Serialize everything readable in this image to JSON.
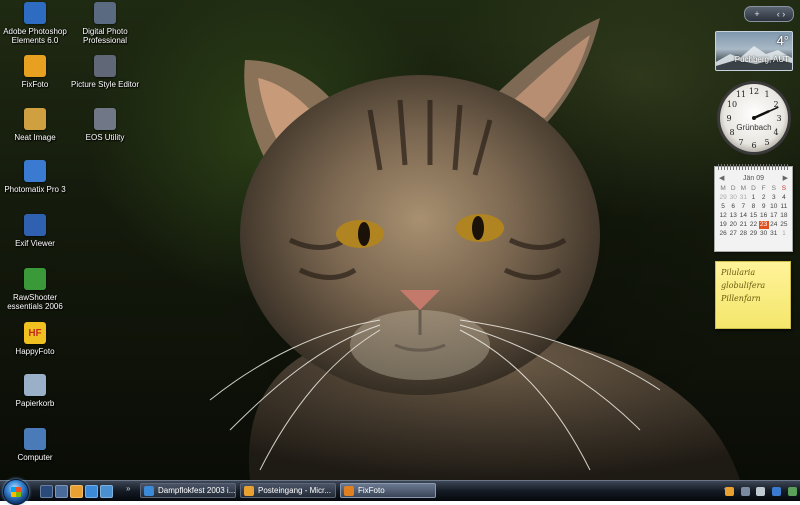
{
  "desktop": {
    "icons": [
      {
        "label": "Adobe Photoshop\nElements 6.0",
        "icon": "photoshop-elements-icon",
        "color": "#2d6cc0"
      },
      {
        "label": "Digital Photo\nProfessional",
        "icon": "digital-photo-professional-icon",
        "color": "#5a6a80"
      },
      {
        "label": "FixFoto",
        "icon": "fixfoto-icon",
        "color": "#e8a020"
      },
      {
        "label": "Picture Style Editor",
        "icon": "picture-style-editor-icon",
        "color": "#606878"
      },
      {
        "label": "Neat Image",
        "icon": "neat-image-icon",
        "color": "#d0a040"
      },
      {
        "label": "EOS Utility",
        "icon": "eos-utility-icon",
        "color": "#707888"
      },
      {
        "label": "Photomatix Pro 3",
        "icon": "photomatix-icon",
        "color": "#3a7ad0"
      },
      {
        "label": "Exif Viewer",
        "icon": "exif-viewer-icon",
        "color": "#3060b0"
      },
      {
        "label": "RawShooter\nessentials 2006",
        "icon": "rawshooter-icon",
        "color": "#3a9a3a"
      },
      {
        "label": "HappyFoto",
        "icon": "happyfoto-icon",
        "color": "#f0c020",
        "glyph": "HF"
      },
      {
        "label": "Papierkorb",
        "icon": "recycle-bin-icon",
        "color": "#9ab0c8"
      },
      {
        "label": "Computer",
        "icon": "computer-icon",
        "color": "#4a7ab8"
      }
    ]
  },
  "sidebar": {
    "controls": {
      "add": "+",
      "nav": "‹ ›"
    },
    "weather": {
      "temp": "4°",
      "city": "Puchberg, AUT"
    },
    "clock": {
      "city": "Grünbach",
      "hour": 2,
      "minute": 11
    },
    "calendar": {
      "month": "Jän 09",
      "weekdays": [
        "M",
        "D",
        "M",
        "D",
        "F",
        "S",
        "S"
      ],
      "weeks": [
        [
          "29",
          "30",
          "31",
          "1",
          "2",
          "3",
          "4"
        ],
        [
          "5",
          "6",
          "7",
          "8",
          "9",
          "10",
          "11"
        ],
        [
          "12",
          "13",
          "14",
          "15",
          "16",
          "17",
          "18"
        ],
        [
          "19",
          "20",
          "21",
          "22",
          "23",
          "24",
          "25"
        ],
        [
          "26",
          "27",
          "28",
          "29",
          "30",
          "31",
          "1"
        ]
      ],
      "today": "23"
    },
    "note": {
      "lines": [
        "Pilularia",
        "globulifera",
        "Pillenfarn"
      ]
    }
  },
  "taskbar": {
    "tasks": [
      {
        "label": "Dampflokfest 2003 i...",
        "icon": "internet-explorer-icon",
        "color": "#3a8ad8"
      },
      {
        "label": "Posteingang - Micr...",
        "icon": "outlook-icon",
        "color": "#e8a030"
      },
      {
        "label": "FixFoto",
        "icon": "fixfoto-icon",
        "color": "#e08020"
      }
    ],
    "overflow": "»"
  }
}
